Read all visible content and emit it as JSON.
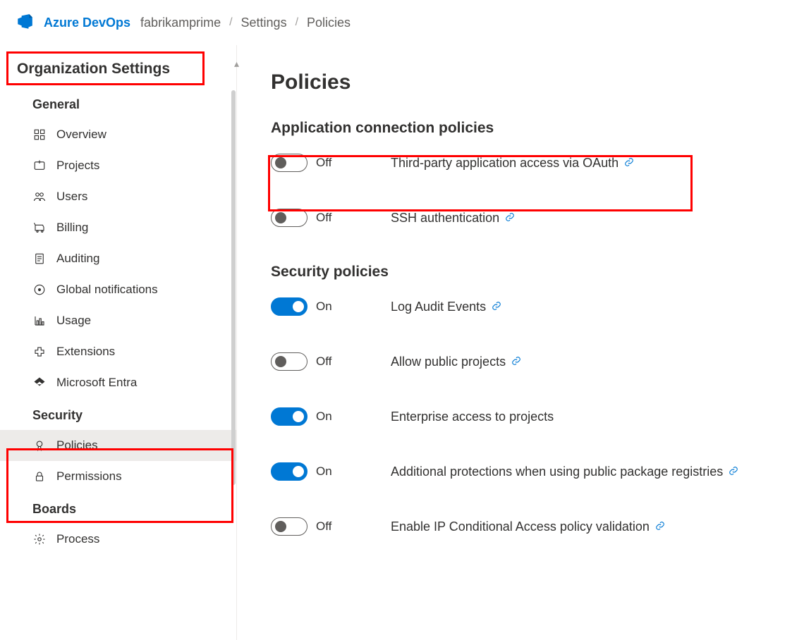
{
  "header": {
    "product": "Azure DevOps",
    "breadcrumb": [
      "fabrikamprime",
      "Settings",
      "Policies"
    ]
  },
  "sidebar": {
    "title": "Organization Settings",
    "groups": [
      {
        "name": "General",
        "items": [
          {
            "label": "Overview",
            "icon": "overview"
          },
          {
            "label": "Projects",
            "icon": "projects"
          },
          {
            "label": "Users",
            "icon": "users"
          },
          {
            "label": "Billing",
            "icon": "billing"
          },
          {
            "label": "Auditing",
            "icon": "auditing"
          },
          {
            "label": "Global notifications",
            "icon": "notifications"
          },
          {
            "label": "Usage",
            "icon": "usage"
          },
          {
            "label": "Extensions",
            "icon": "extensions"
          },
          {
            "label": "Microsoft Entra",
            "icon": "entra"
          }
        ]
      },
      {
        "name": "Security",
        "items": [
          {
            "label": "Policies",
            "icon": "policies",
            "selected": true
          },
          {
            "label": "Permissions",
            "icon": "permissions"
          }
        ]
      },
      {
        "name": "Boards",
        "items": [
          {
            "label": "Process",
            "icon": "process"
          }
        ]
      }
    ]
  },
  "main": {
    "title": "Policies",
    "sections": [
      {
        "title": "Application connection policies",
        "policies": [
          {
            "label": "Third-party application access via OAuth",
            "state": "Off",
            "on": false,
            "link": true
          },
          {
            "label": "SSH authentication",
            "state": "Off",
            "on": false,
            "link": true
          }
        ]
      },
      {
        "title": "Security policies",
        "policies": [
          {
            "label": "Log Audit Events",
            "state": "On",
            "on": true,
            "link": true
          },
          {
            "label": "Allow public projects",
            "state": "Off",
            "on": false,
            "link": true
          },
          {
            "label": "Enterprise access to projects",
            "state": "On",
            "on": true,
            "link": false
          },
          {
            "label": "Additional protections when using public package registries",
            "state": "On",
            "on": true,
            "link": true
          },
          {
            "label": "Enable IP Conditional Access policy validation",
            "state": "Off",
            "on": false,
            "link": true
          }
        ]
      }
    ]
  }
}
